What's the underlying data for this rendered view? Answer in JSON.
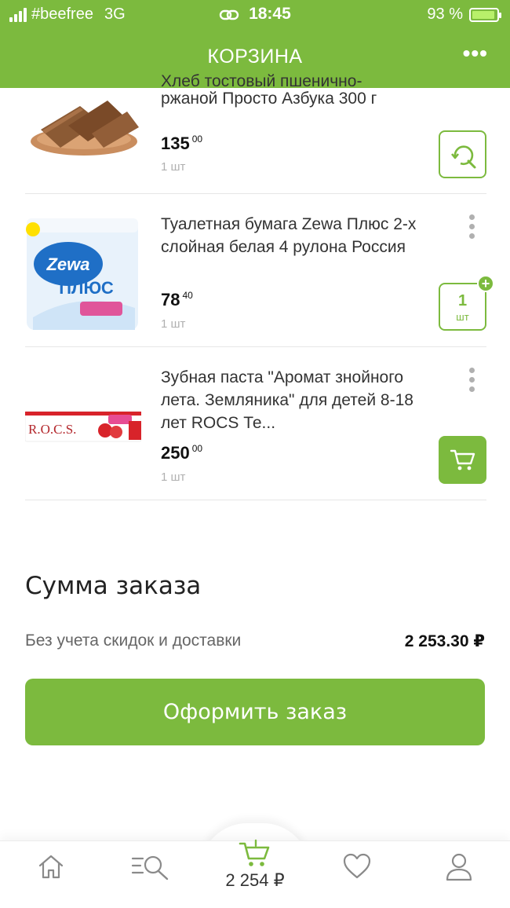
{
  "status_bar": {
    "carrier": "#beefree",
    "network": "3G",
    "time": "18:45",
    "battery": "93 %"
  },
  "header": {
    "title": "КОРЗИНА",
    "more_icon": "more-horizontal-icon"
  },
  "items": [
    {
      "name_cut": "Хлеб тостовый пшенично-",
      "name": "ржаной Просто Азбука 300 г",
      "price_int": "135",
      "price_dec": "00",
      "qty": "1 шт",
      "action_icon": "find-replacement-icon"
    },
    {
      "name": "Туалетная бумага Zewa Плюс 2-х слойная белая 4 рулона Россия",
      "price_int": "78",
      "price_dec": "40",
      "qty": "1 шт",
      "stepper_count": "1",
      "stepper_unit": "шт"
    },
    {
      "name": "Зубная паста \"Аромат знойного лета. Земляника\" для детей 8-18 лет ROCS Те...",
      "price_int": "250",
      "price_dec": "00",
      "qty": "1 шт",
      "action_icon": "cart-icon"
    }
  ],
  "summary": {
    "title": "Сумма заказа",
    "label": "Без учета скидок и доставки",
    "value": "2 253.30 ₽",
    "checkout_label": "Оформить заказ"
  },
  "tabbar": {
    "cart_total": "2 254 ₽",
    "accent": "#7cba3e"
  },
  "colors": {
    "brand_green": "#7cba3e",
    "muted_text": "#b0b0b0"
  }
}
